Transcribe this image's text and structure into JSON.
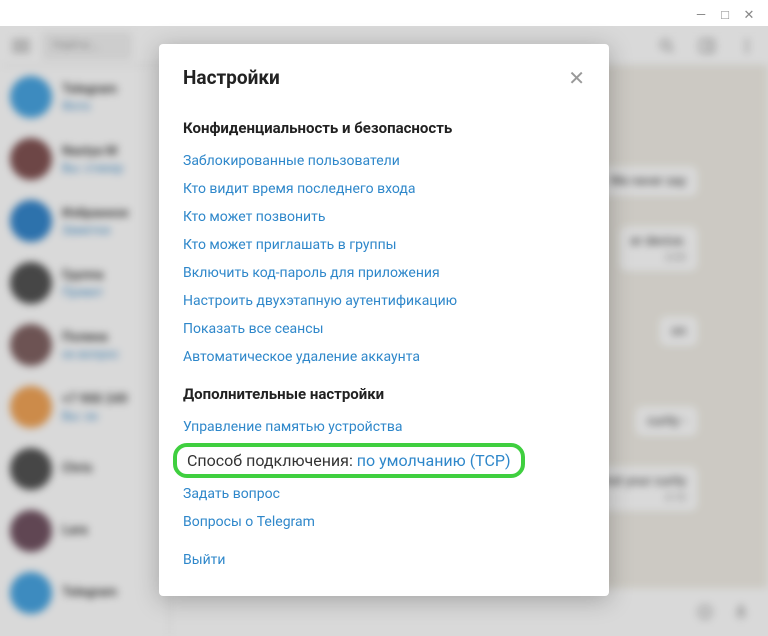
{
  "window": {
    "minimize": "—",
    "maximize": "□",
    "close": "✕"
  },
  "topbar": {
    "search_placeholder": "Найти..."
  },
  "sidebar": {
    "chats": [
      {
        "name": "Telegram",
        "preview": "Фото"
      },
      {
        "name": "Nastya M",
        "preview": "Вы: стикер"
      },
      {
        "name": "Избранное",
        "preview": "Заметки"
      },
      {
        "name": "Группа",
        "preview": "Привет"
      },
      {
        "name": "Полина",
        "preview": "ок вопрос"
      },
      {
        "name": "+7 900 249",
        "preview": "Вы: ок"
      },
      {
        "name": "Chris",
        "preview": ""
      },
      {
        "name": "Lara",
        "preview": ""
      },
      {
        "name": "Telegram",
        "preview": ""
      }
    ]
  },
  "messages": {
    "m1": {
      "text": "We never say",
      "time": ""
    },
    "m2": {
      "text": "er device.",
      "time": "3:09"
    },
    "m3": {
      "text": "on",
      "time": ""
    },
    "m4": {
      "text": "curity -",
      "time": ""
    },
    "m5": {
      "text": "inst your curity",
      "time": "3:10"
    }
  },
  "modal": {
    "title": "Настройки",
    "section1": {
      "title": "Конфиденциальность и безопасность",
      "items": [
        "Заблокированные пользователи",
        "Кто видит время последнего входа",
        "Кто может позвонить",
        "Кто может приглашать в группы",
        "Включить код-пароль для приложения",
        "Настроить двухэтапную аутентификацию",
        "Показать все сеансы",
        "Автоматическое удаление аккаунта"
      ]
    },
    "section2": {
      "title": "Дополнительные настройки",
      "memory": "Управление памятью устройства",
      "connection_label": "Способ подключения: ",
      "connection_value": "по умолчанию (TCP)",
      "ask": "Задать вопрос",
      "faq": "Вопросы о Telegram",
      "logout": "Выйти"
    }
  },
  "avatar_colors": [
    "#3fa0e0",
    "#7b4a4a",
    "#2b80c9",
    "#4a4a4a",
    "#7a5a5a",
    "#f0a050",
    "#4a4a4a",
    "#6a4a5a",
    "#3fa0e0"
  ]
}
